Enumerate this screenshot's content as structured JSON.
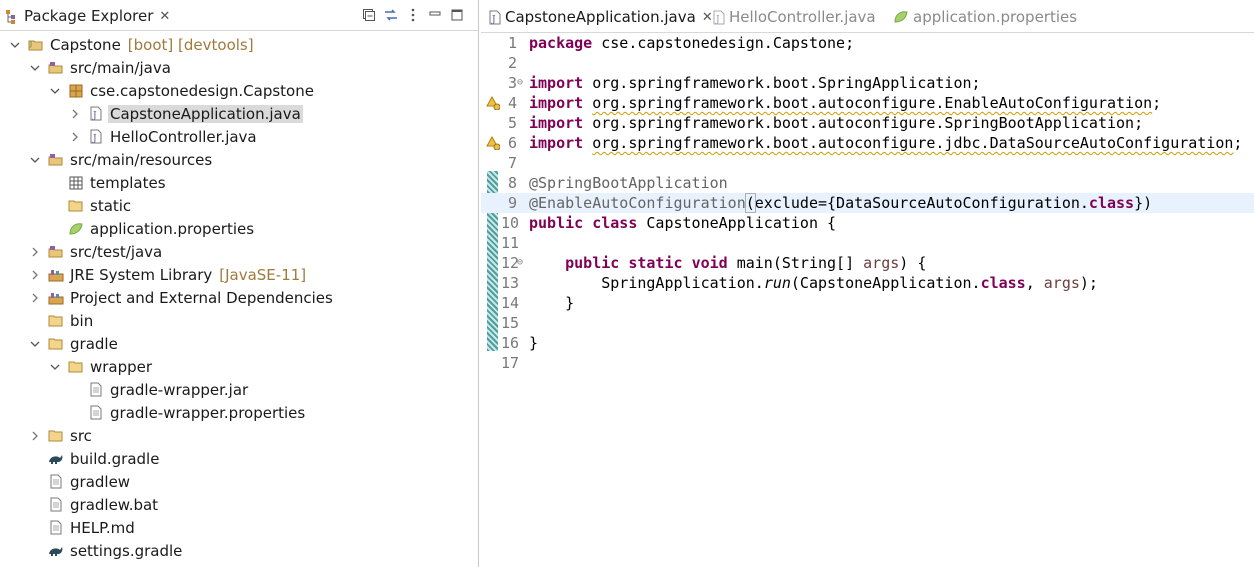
{
  "explorer": {
    "title": "Package Explorer",
    "tree": [
      {
        "label": "Capstone",
        "decoration": "[boot] [devtools]",
        "depth": 0,
        "expanded": true,
        "icon": "project-icon"
      },
      {
        "label": "src/main/java",
        "depth": 1,
        "expanded": true,
        "icon": "source-folder-icon"
      },
      {
        "label": "cse.capstonedesign.Capstone",
        "depth": 2,
        "expanded": true,
        "icon": "package-icon"
      },
      {
        "label": "CapstoneApplication.java",
        "depth": 3,
        "expanded": false,
        "icon": "java-file-icon",
        "selected": true
      },
      {
        "label": "HelloController.java",
        "depth": 3,
        "expanded": false,
        "icon": "java-file-icon"
      },
      {
        "label": "src/main/resources",
        "depth": 1,
        "expanded": true,
        "icon": "source-folder-icon"
      },
      {
        "label": "templates",
        "depth": 2,
        "icon": "folder-grid-icon"
      },
      {
        "label": "static",
        "depth": 2,
        "icon": "folder-icon"
      },
      {
        "label": "application.properties",
        "depth": 2,
        "icon": "leaf-icon"
      },
      {
        "label": "src/test/java",
        "depth": 1,
        "expanded": false,
        "icon": "source-folder-icon"
      },
      {
        "label": "JRE System Library",
        "decoration": "[JavaSE-11]",
        "depth": 1,
        "expanded": false,
        "icon": "library-icon"
      },
      {
        "label": "Project and External Dependencies",
        "depth": 1,
        "expanded": false,
        "icon": "library-icon"
      },
      {
        "label": "bin",
        "depth": 1,
        "icon": "folder-icon"
      },
      {
        "label": "gradle",
        "depth": 1,
        "expanded": true,
        "icon": "folder-icon"
      },
      {
        "label": "wrapper",
        "depth": 2,
        "expanded": true,
        "icon": "folder-icon"
      },
      {
        "label": "gradle-wrapper.jar",
        "depth": 3,
        "icon": "file-icon"
      },
      {
        "label": "gradle-wrapper.properties",
        "depth": 3,
        "icon": "file-icon"
      },
      {
        "label": "src",
        "depth": 1,
        "expanded": false,
        "icon": "folder-icon"
      },
      {
        "label": "build.gradle",
        "depth": 1,
        "icon": "gradle-icon"
      },
      {
        "label": "gradlew",
        "depth": 1,
        "icon": "file-icon"
      },
      {
        "label": "gradlew.bat",
        "depth": 1,
        "icon": "file-icon"
      },
      {
        "label": "HELP.md",
        "depth": 1,
        "icon": "file-icon"
      },
      {
        "label": "settings.gradle",
        "depth": 1,
        "icon": "gradle-icon"
      }
    ]
  },
  "editor": {
    "tabs": [
      {
        "label": "CapstoneApplication.java",
        "active": true
      },
      {
        "label": "HelloController.java",
        "active": false
      },
      {
        "label": "application.properties",
        "active": false
      }
    ],
    "line_numbers": [
      "1",
      "2",
      "3",
      "4",
      "5",
      "6",
      "7",
      "8",
      "9",
      "10",
      "11",
      "12",
      "13",
      "14",
      "15",
      "16",
      "17"
    ],
    "code": {
      "l1_kw": "package",
      "l1_rest": " cse.capstonedesign.Capstone;",
      "imp": "import",
      "l3_rest": " org.springframework.boot.SpringApplication;",
      "l4_rest": "org.springframework.boot.autoconfigure.EnableAutoConfiguration",
      "l5_rest": " org.springframework.boot.autoconfigure.SpringBootApplication;",
      "l6_rest": "org.springframework.boot.autoconfigure.jdbc.DataSourceAutoConfiguration",
      "semi": ";",
      "l8": "@SpringBootApplication",
      "l9_ann": "@EnableAutoConfiguration",
      "l9_open": "(",
      "l9_mid": "exclude={DataSourceAutoConfiguration.",
      "l9_kw": "class",
      "l9_end": "})",
      "l10_kw1": "public",
      "l10_kw2": "class",
      "l10_rest": " CapstoneApplication {",
      "l12_kw1": "public",
      "l12_kw2": "static",
      "l12_kw3": "void",
      "l12_mid": " main(String[] ",
      "l12_arg": "args",
      "l12_end": ") {",
      "l13_pre": "SpringApplication.",
      "l13_run": "run",
      "l13_mid": "(CapstoneApplication.",
      "l13_kw": "class",
      "l13_sep": ", ",
      "l13_arg": "args",
      "l13_end": ");",
      "l14": "}",
      "l16": "}"
    }
  }
}
